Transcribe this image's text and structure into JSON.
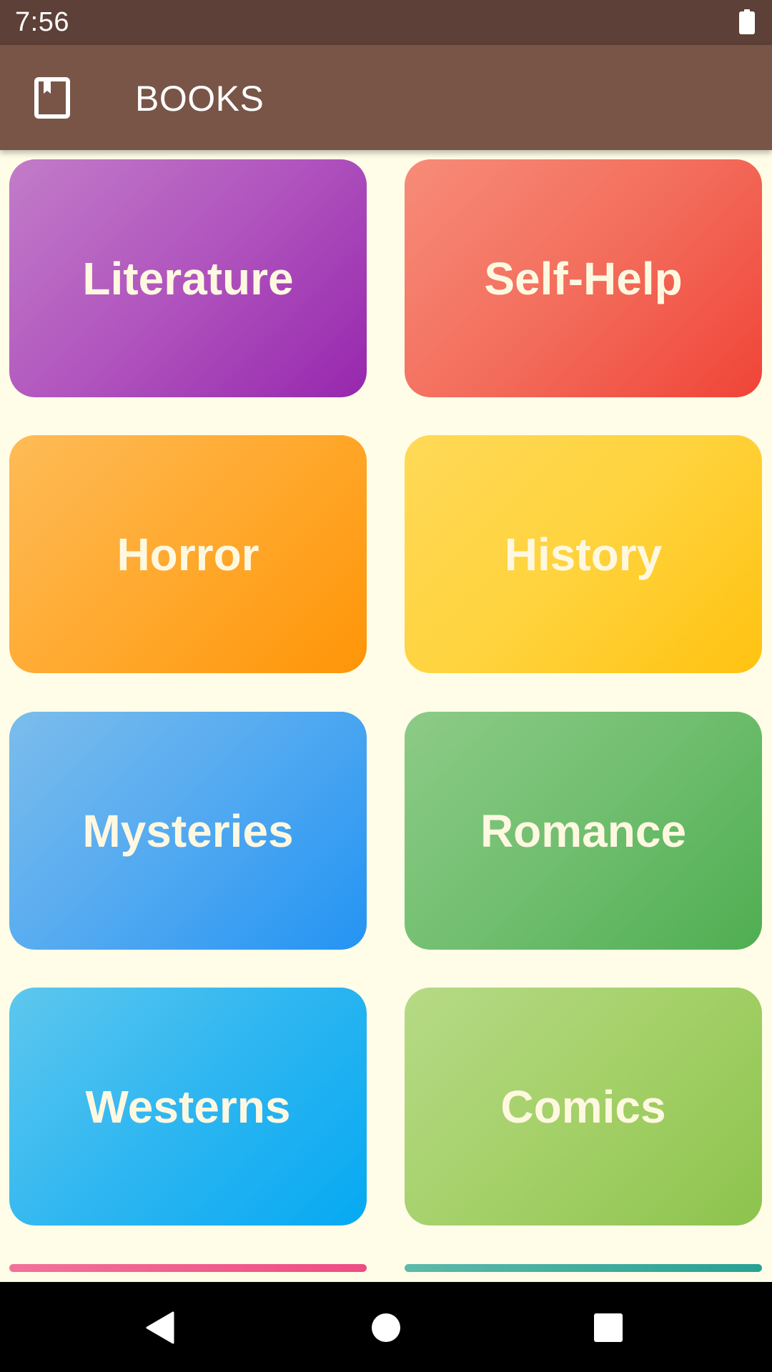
{
  "status_bar": {
    "time": "7:56",
    "battery_icon": "battery-full-icon"
  },
  "app_bar": {
    "icon": "bookmark-book-icon",
    "title": "BOOKS",
    "background_color": "#795548"
  },
  "categories": [
    {
      "label": "Literature",
      "colors": [
        "#C27CC8",
        "#9727AD"
      ]
    },
    {
      "label": "Self-Help",
      "colors": [
        "#F78C79",
        "#F04437"
      ]
    },
    {
      "label": "Horror",
      "colors": [
        "#FEBB57",
        "#FF9507"
      ]
    },
    {
      "label": "History",
      "colors": [
        "#FFD957",
        "#FFC210"
      ]
    },
    {
      "label": "Mysteries",
      "colors": [
        "#7CBDEB",
        "#2394F2"
      ]
    },
    {
      "label": "Romance",
      "colors": [
        "#8DCB86",
        "#4FAE51"
      ]
    },
    {
      "label": "Westerns",
      "colors": [
        "#5EC7EE",
        "#06A9F2"
      ]
    },
    {
      "label": "Comics",
      "colors": [
        "#B6DA86",
        "#8DC34D"
      ]
    },
    {
      "label": "",
      "colors": [
        "#F2719A",
        "#EF4C83"
      ]
    },
    {
      "label": "",
      "colors": [
        "#5DBAAA",
        "#27A193"
      ]
    }
  ],
  "nav_bar": {
    "back_icon": "back-triangle-icon",
    "home_icon": "home-circle-icon",
    "recents_icon": "recents-square-icon"
  },
  "theme": {
    "status_bar_color": "#5D4037",
    "background_color": "#FFFDE7",
    "tile_text_color": "#FFF8E1"
  }
}
